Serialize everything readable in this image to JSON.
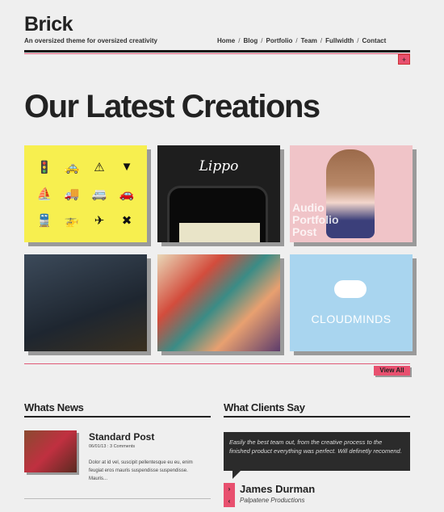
{
  "header": {
    "logo": "Brick",
    "tagline": "An oversized theme for oversized creativity",
    "nav": [
      "Home",
      "Blog",
      "Portfolio",
      "Team",
      "Fullwidth",
      "Contact"
    ],
    "nav_separator": "/",
    "plus_label": "+"
  },
  "main": {
    "title": "Our Latest Creations",
    "portfolio": {
      "icons": [
        "🚦",
        "🚕",
        "⚠",
        "▼",
        "⛵",
        "🚚",
        "🚐",
        "🚗",
        "🚆",
        "🚁",
        "✈",
        "✖"
      ],
      "lippo": "Lippo",
      "audio_post": [
        "Audio",
        "Portfolio",
        "Post"
      ],
      "cloudminds": "CLOUDMINDS"
    },
    "view_all": "View All"
  },
  "news": {
    "heading": "Whats News",
    "post_title": "Standard Post",
    "post_meta": "06/01/13 : 3 Comments",
    "excerpt": "Dolor at id vel, suscipit pellentesque eu eu, enim feugiat eros mauris suspendisse suspendisse. Mauris..."
  },
  "clients": {
    "heading": "What Clients Say",
    "quote": "Easily the best team out, from the creative process to the finished product everything was perfect. Will definetly recomend.",
    "name": "James Durman",
    "company": "Palpatene Productions",
    "next": "›",
    "prev": "‹"
  },
  "colors": {
    "accent": "#e8506f",
    "dark": "#2b2b2b",
    "yellow": "#f7ef4f"
  }
}
